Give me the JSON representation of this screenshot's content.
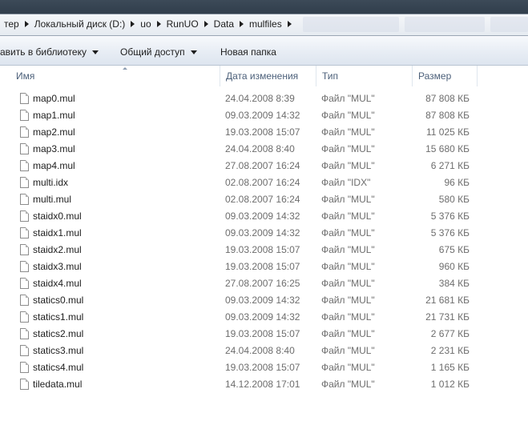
{
  "breadcrumb": [
    {
      "label": "тер"
    },
    {
      "label": "Локальный диск (D:)"
    },
    {
      "label": "uo"
    },
    {
      "label": "RunUO"
    },
    {
      "label": "Data"
    },
    {
      "label": "mulfiles"
    }
  ],
  "toolbar": {
    "library_label": "авить в библиотеку",
    "share_label": "Общий доступ",
    "new_folder_label": "Новая папка"
  },
  "columns": {
    "name": "Имя",
    "date": "Дата изменения",
    "type": "Тип",
    "size": "Размер"
  },
  "files": [
    {
      "name": "map0.mul",
      "date": "24.04.2008 8:39",
      "type": "Файл \"MUL\"",
      "size": "87 808 КБ"
    },
    {
      "name": "map1.mul",
      "date": "09.03.2009 14:32",
      "type": "Файл \"MUL\"",
      "size": "87 808 КБ"
    },
    {
      "name": "map2.mul",
      "date": "19.03.2008 15:07",
      "type": "Файл \"MUL\"",
      "size": "11 025 КБ"
    },
    {
      "name": "map3.mul",
      "date": "24.04.2008 8:40",
      "type": "Файл \"MUL\"",
      "size": "15 680 КБ"
    },
    {
      "name": "map4.mul",
      "date": "27.08.2007 16:24",
      "type": "Файл \"MUL\"",
      "size": "6 271 КБ"
    },
    {
      "name": "multi.idx",
      "date": "02.08.2007 16:24",
      "type": "Файл \"IDX\"",
      "size": "96 КБ"
    },
    {
      "name": "multi.mul",
      "date": "02.08.2007 16:24",
      "type": "Файл \"MUL\"",
      "size": "580 КБ"
    },
    {
      "name": "staidx0.mul",
      "date": "09.03.2009 14:32",
      "type": "Файл \"MUL\"",
      "size": "5 376 КБ"
    },
    {
      "name": "staidx1.mul",
      "date": "09.03.2009 14:32",
      "type": "Файл \"MUL\"",
      "size": "5 376 КБ"
    },
    {
      "name": "staidx2.mul",
      "date": "19.03.2008 15:07",
      "type": "Файл \"MUL\"",
      "size": "675 КБ"
    },
    {
      "name": "staidx3.mul",
      "date": "19.03.2008 15:07",
      "type": "Файл \"MUL\"",
      "size": "960 КБ"
    },
    {
      "name": "staidx4.mul",
      "date": "27.08.2007 16:25",
      "type": "Файл \"MUL\"",
      "size": "384 КБ"
    },
    {
      "name": "statics0.mul",
      "date": "09.03.2009 14:32",
      "type": "Файл \"MUL\"",
      "size": "21 681 КБ"
    },
    {
      "name": "statics1.mul",
      "date": "09.03.2009 14:32",
      "type": "Файл \"MUL\"",
      "size": "21 731 КБ"
    },
    {
      "name": "statics2.mul",
      "date": "19.03.2008 15:07",
      "type": "Файл \"MUL\"",
      "size": "2 677 КБ"
    },
    {
      "name": "statics3.mul",
      "date": "24.04.2008 8:40",
      "type": "Файл \"MUL\"",
      "size": "2 231 КБ"
    },
    {
      "name": "statics4.mul",
      "date": "19.03.2008 15:07",
      "type": "Файл \"MUL\"",
      "size": "1 165 КБ"
    },
    {
      "name": "tiledata.mul",
      "date": "14.12.2008 17:01",
      "type": "Файл \"MUL\"",
      "size": "1 012 КБ"
    }
  ]
}
